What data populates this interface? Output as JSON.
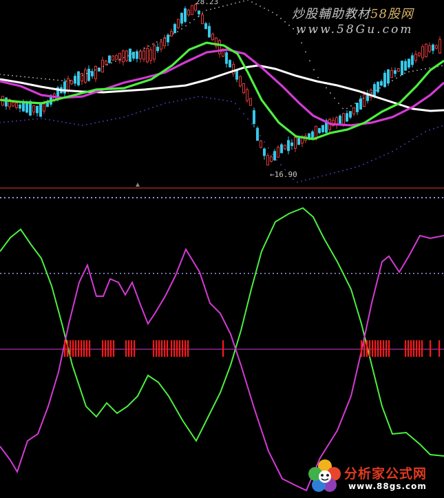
{
  "watermark": {
    "line1_prefix": "炒股輔助教材",
    "line1_highlight": "58股网",
    "line2": "www.58Gu.com"
  },
  "price_labels": {
    "top_high": "28.23",
    "low": "←16.90"
  },
  "logo": {
    "text": "分析家公式网",
    "url": "www.88gs.com"
  },
  "colors": {
    "background": "#000000",
    "green_line": "#4cf040",
    "magenta_line": "#d43bd4",
    "white_ma": "#ffffff",
    "candle_up": "#e23a3a",
    "candle_down": "#36c8e8",
    "signal_bar": "#ff1818",
    "separator": "#b43220"
  }
}
